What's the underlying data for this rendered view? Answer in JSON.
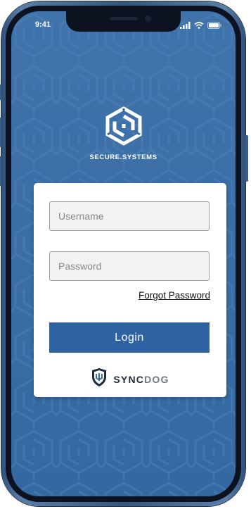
{
  "status_bar": {
    "time": "9:41",
    "icons": [
      "signal-icon",
      "wifi-icon",
      "battery-icon"
    ]
  },
  "brand": {
    "name": "SECURE.SYSTEMS",
    "icon": "secure-systems-logo-icon"
  },
  "login": {
    "username_placeholder": "Username",
    "username_value": "",
    "password_placeholder": "Password",
    "password_value": "",
    "forgot_label": "Forgot Password",
    "button_label": "Login"
  },
  "footer": {
    "logo_sync": "SYNC",
    "logo_dog": "DOG",
    "logo_icon": "syncdog-shield-icon"
  },
  "colors": {
    "background": "#3a6ea5",
    "button": "#2e62a0",
    "card": "#ffffff",
    "device_frame": "#36567f"
  }
}
